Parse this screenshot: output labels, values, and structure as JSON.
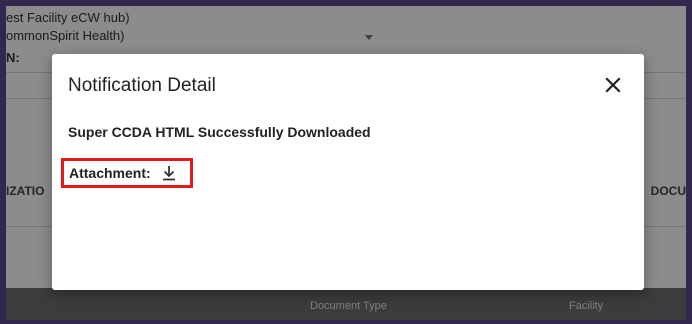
{
  "background": {
    "facility_line1": "est Facility eCW hub)",
    "facility_line2": "ommonSpirit Health)",
    "label_fragment": "N:",
    "col_left": "IZATIO",
    "col_right": "DOCU",
    "footer_document_type": "Document Type",
    "footer_facility": "Facility"
  },
  "modal": {
    "title": "Notification Detail",
    "message": "Super CCDA HTML Successfully Downloaded",
    "attachment_label": "Attachment:"
  },
  "colors": {
    "highlight": "#e21a1a",
    "frame": "#5b4a8c"
  },
  "icons": {
    "close": "close-icon",
    "download": "download-icon",
    "dropdown": "chevron-down-icon"
  }
}
